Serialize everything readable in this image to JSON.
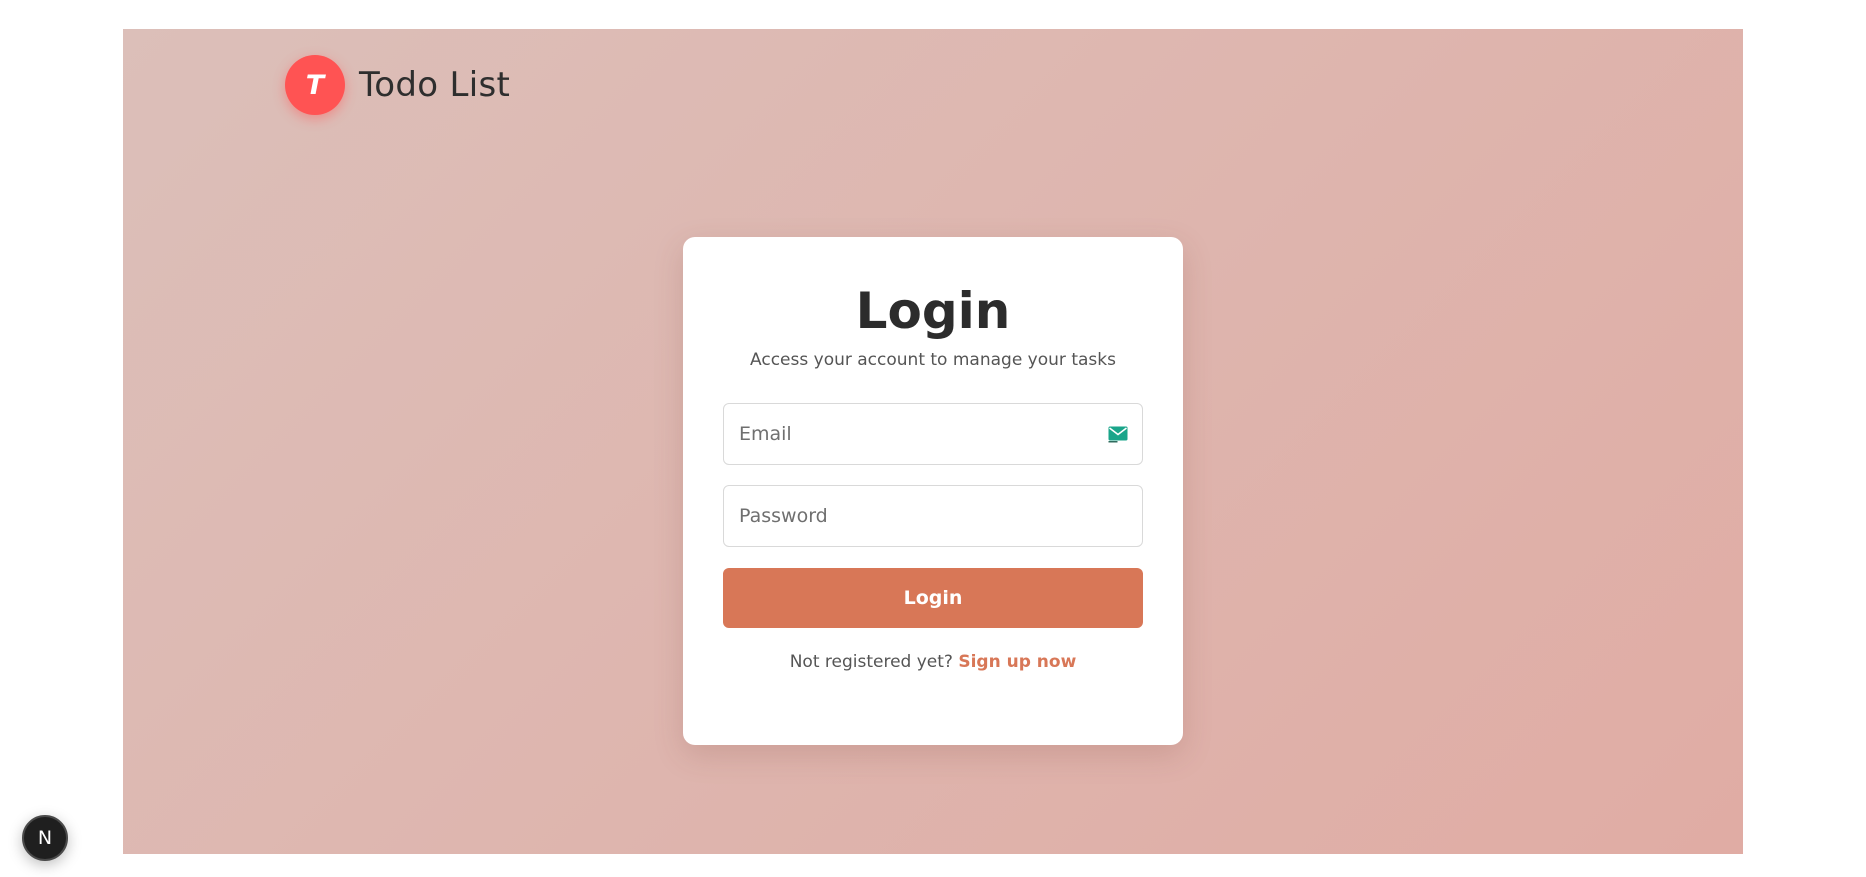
{
  "brand": {
    "initial": "T",
    "name": "Todo List",
    "badge_color": "#ff5353"
  },
  "login_card": {
    "title": "Login",
    "subtitle": "Access your account to manage your tasks",
    "email": {
      "placeholder": "Email",
      "value": "",
      "icon": "mail-icon"
    },
    "password": {
      "placeholder": "Password",
      "value": ""
    },
    "submit_label": "Login",
    "signup_prompt": "Not registered yet?",
    "signup_link": "Sign up now"
  },
  "dev_badge": {
    "label": "N",
    "icon": "nextjs-icon"
  },
  "colors": {
    "background_start": "#dcbfb9",
    "background_end": "#e0aca4",
    "accent": "#d87757",
    "mail_icon": "#1aa58a"
  }
}
